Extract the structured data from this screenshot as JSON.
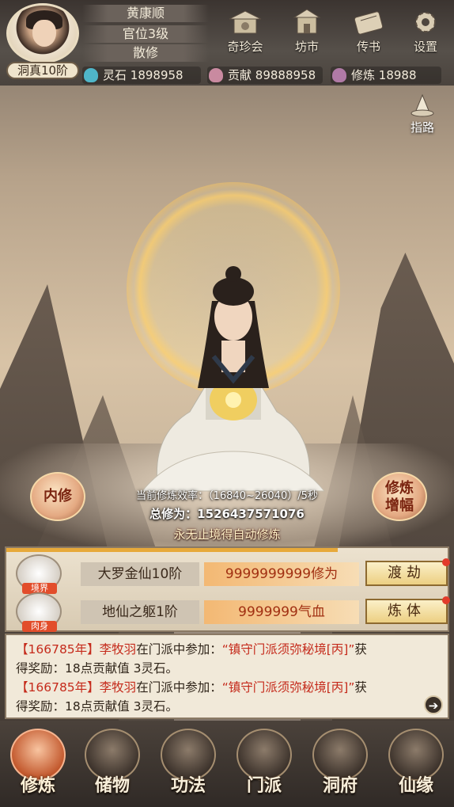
{
  "player": {
    "name": "黄康顺",
    "rank": "官位3级",
    "title": "散修",
    "realm_badge": "洞真10阶"
  },
  "top_menu": [
    {
      "label": "奇珍会",
      "icon": "treasure-pavilion-icon"
    },
    {
      "label": "坊市",
      "icon": "market-icon"
    },
    {
      "label": "传书",
      "icon": "scroll-letter-icon"
    },
    {
      "label": "设置",
      "icon": "gear-icon"
    }
  ],
  "resources": {
    "spirit_stone": {
      "label": "灵石",
      "value": "1898958",
      "color": "#4fb6c9"
    },
    "contribution": {
      "label": "贡献",
      "value": "89888958",
      "color": "#c98aa0"
    },
    "cultivation": {
      "label": "修炼",
      "value": "18988",
      "color": "#b07aa6"
    }
  },
  "guide": {
    "label": "指路"
  },
  "center": {
    "inner_btn": "内修",
    "boost_btn_line1": "修炼",
    "boost_btn_line2": "增幅",
    "efficiency": "当前修炼效率：（16840~26040）/5秒",
    "total": "总修为：1526437571076",
    "auto_note": "永无止境得自动修炼",
    "progress": 0.75
  },
  "rows": [
    {
      "tag": "境界",
      "name": "大罗金仙10阶",
      "value": "9999999999修为",
      "button": "渡劫"
    },
    {
      "tag": "肉身",
      "name": "地仙之躯1阶",
      "value": "9999999气血",
      "button": "炼体"
    }
  ],
  "log": [
    {
      "year": "【166785年】",
      "name": "李牧羽",
      "mid": "在门派中参加：",
      "event": "“镇守门派须弥秘境[丙]”",
      "tail": "获",
      "line2": "得奖励：18点贡献值 3灵石。"
    },
    {
      "year": "【166785年】",
      "name": "李牧羽",
      "mid": "在门派中参加：",
      "event": "“镇守门派须弥秘境[丙]”",
      "tail": "获",
      "line2": "得奖励：18点贡献值 3灵石。"
    }
  ],
  "nav": [
    {
      "label": "修炼",
      "active": true
    },
    {
      "label": "储物"
    },
    {
      "label": "功法"
    },
    {
      "label": "门派"
    },
    {
      "label": "洞府"
    },
    {
      "label": "仙缘"
    }
  ]
}
